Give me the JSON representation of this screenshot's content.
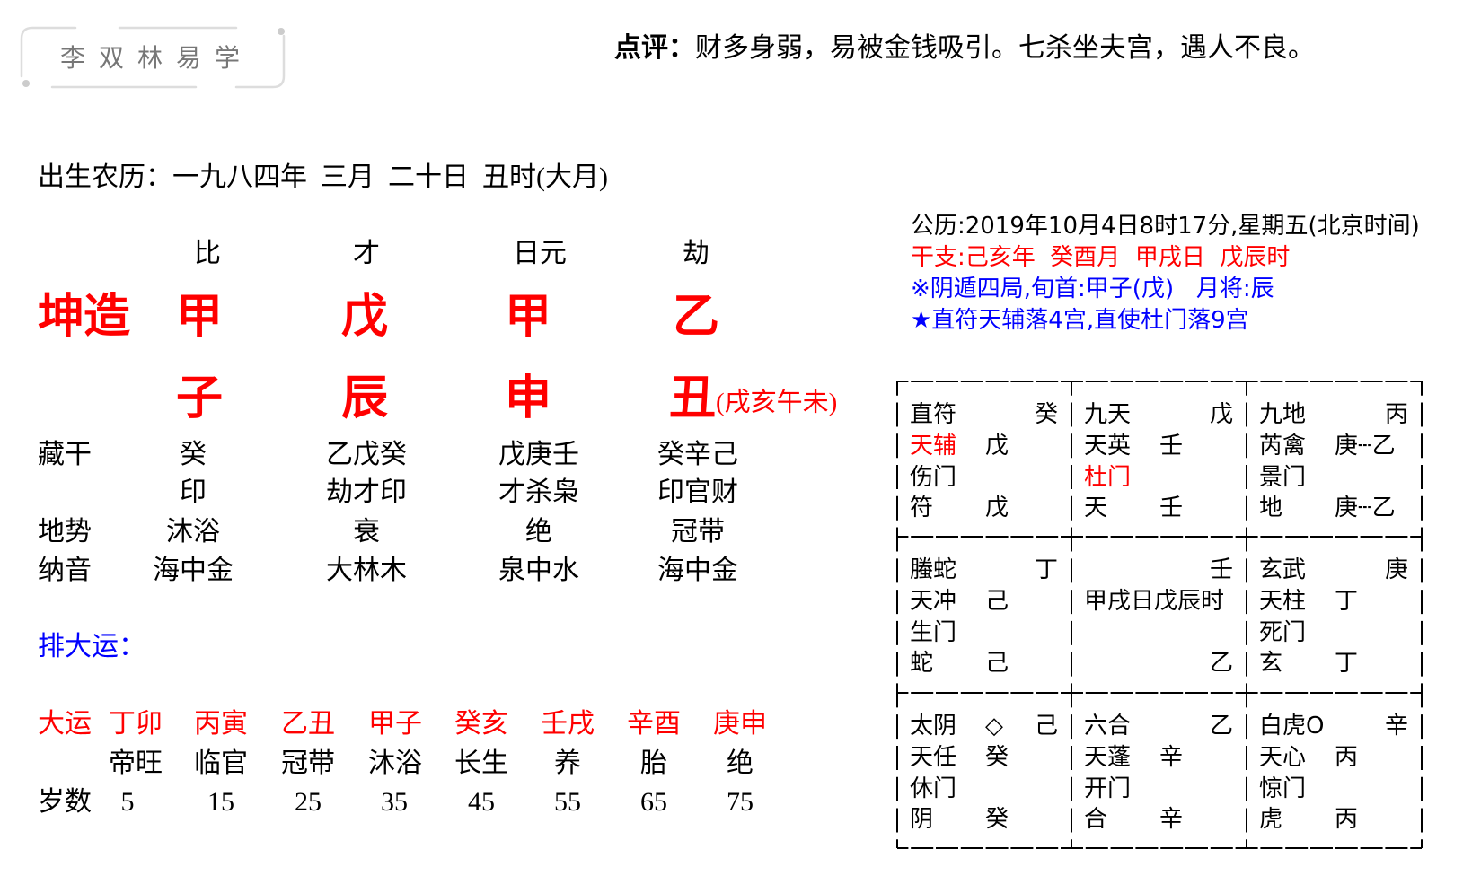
{
  "header": {
    "logo_text": "李双林易学",
    "comment_label": "点评：",
    "comment_text": "财多身弱，易被金钱吸引。七杀坐夫宫，遇人不良。"
  },
  "birth": {
    "label": "出生农历：",
    "value": "一九八四年  三月  二十日  丑时(大月)"
  },
  "bazi": {
    "gender_label": "坤造",
    "ten_gods": [
      "比",
      "才",
      "日元",
      "劫"
    ],
    "stems": [
      "甲",
      "戊",
      "甲",
      "乙"
    ],
    "branches": [
      "子",
      "辰",
      "申",
      "丑"
    ],
    "kong_wang": "(戌亥午未)",
    "hidden_label": "藏干",
    "hidden_stems": [
      "癸",
      "乙戊癸",
      "戊庚壬",
      "癸辛己"
    ],
    "hidden_gods": [
      "印",
      "劫才印",
      "才杀枭",
      "印官财"
    ],
    "terrain_label": "地势",
    "terrain": [
      "沐浴",
      "衰",
      "绝",
      "冠带"
    ],
    "nayin_label": "纳音",
    "nayin": [
      "海中金",
      "大林木",
      "泉中水",
      "海中金"
    ]
  },
  "dayun": {
    "heading": "排大运：",
    "label": "大运",
    "pillars": [
      "丁卯",
      "丙寅",
      "乙丑",
      "甲子",
      "癸亥",
      "壬戌",
      "辛酉",
      "庚申"
    ],
    "stages": [
      "帝旺",
      "临官",
      "冠带",
      "沐浴",
      "长生",
      "养",
      "胎",
      "绝"
    ],
    "age_label": "岁数",
    "ages": [
      "5",
      "15",
      "25",
      "35",
      "45",
      "55",
      "65",
      "75"
    ]
  },
  "qimen": {
    "gregorian": "公历:2019年10月4日8时17分,星期五(北京时间)",
    "ganzhi": "干支:己亥年  癸酉月  甲戌日  戊辰时",
    "ju_info": "※阴遁四局,旬首:甲子(戊)   月将:辰",
    "zhifu_info": "★直符天辅落4宫,直使杜门落9宫",
    "palaces": [
      {
        "lines": [
          {
            "left": "直符",
            "mid": "",
            "right": "癸"
          },
          {
            "left": "天辅",
            "mid": "戊",
            "right": "",
            "left_color": "#ff0000"
          },
          {
            "left": "伤门",
            "mid": "",
            "right": ""
          },
          {
            "left": "符",
            "mid": "戊",
            "right": ""
          }
        ]
      },
      {
        "lines": [
          {
            "left": "九天",
            "mid": "",
            "right": "戊"
          },
          {
            "left": "天英",
            "mid": "壬",
            "right": ""
          },
          {
            "left": "杜门",
            "mid": "",
            "right": "",
            "left_color": "#ff0000"
          },
          {
            "left": "天",
            "mid": "壬",
            "right": ""
          }
        ]
      },
      {
        "lines": [
          {
            "left": "九地",
            "mid": "",
            "right": "丙"
          },
          {
            "left": "芮禽",
            "mid": "庚┄乙",
            "right": ""
          },
          {
            "left": "景门",
            "mid": "",
            "right": ""
          },
          {
            "left": "地",
            "mid": "庚┄乙",
            "right": ""
          }
        ]
      },
      {
        "lines": [
          {
            "left": "螣蛇",
            "mid": "",
            "right": "丁"
          },
          {
            "left": "天冲",
            "mid": "己",
            "right": ""
          },
          {
            "left": "生门",
            "mid": "",
            "right": ""
          },
          {
            "left": "蛇",
            "mid": "己",
            "right": ""
          }
        ]
      },
      {
        "lines": [
          {
            "left": "",
            "mid": "",
            "right": "壬"
          },
          {
            "left": "甲戌日戊辰时",
            "mid": "",
            "right": ""
          },
          {
            "left": "",
            "mid": "",
            "right": ""
          },
          {
            "left": "",
            "mid": "",
            "right": "乙"
          }
        ]
      },
      {
        "lines": [
          {
            "left": "玄武",
            "mid": "",
            "right": "庚"
          },
          {
            "left": "天柱",
            "mid": "丁",
            "right": ""
          },
          {
            "left": "死门",
            "mid": "",
            "right": ""
          },
          {
            "left": "玄",
            "mid": "丁",
            "right": ""
          }
        ]
      },
      {
        "lines": [
          {
            "left": "太阴",
            "mid": "◇",
            "right": "己"
          },
          {
            "left": "天任",
            "mid": "癸",
            "right": ""
          },
          {
            "left": "休门",
            "mid": "",
            "right": ""
          },
          {
            "left": "阴",
            "mid": "癸",
            "right": ""
          }
        ]
      },
      {
        "lines": [
          {
            "left": "六合",
            "mid": "",
            "right": "乙"
          },
          {
            "left": "天蓬",
            "mid": "辛",
            "right": ""
          },
          {
            "left": "开门",
            "mid": "",
            "right": ""
          },
          {
            "left": "合",
            "mid": "辛",
            "right": ""
          }
        ]
      },
      {
        "lines": [
          {
            "left": "白虎O",
            "mid": "",
            "right": "辛"
          },
          {
            "left": "天心",
            "mid": "丙",
            "right": ""
          },
          {
            "left": "惊门",
            "mid": "",
            "right": ""
          },
          {
            "left": "虎",
            "mid": "丙",
            "right": ""
          }
        ]
      }
    ]
  },
  "colors": {
    "accent_red": "#ff0000",
    "accent_blue": "#0000ff",
    "logo_text": "#777777",
    "logo_frame": "#dddddd",
    "grid_lines": "#000000"
  }
}
